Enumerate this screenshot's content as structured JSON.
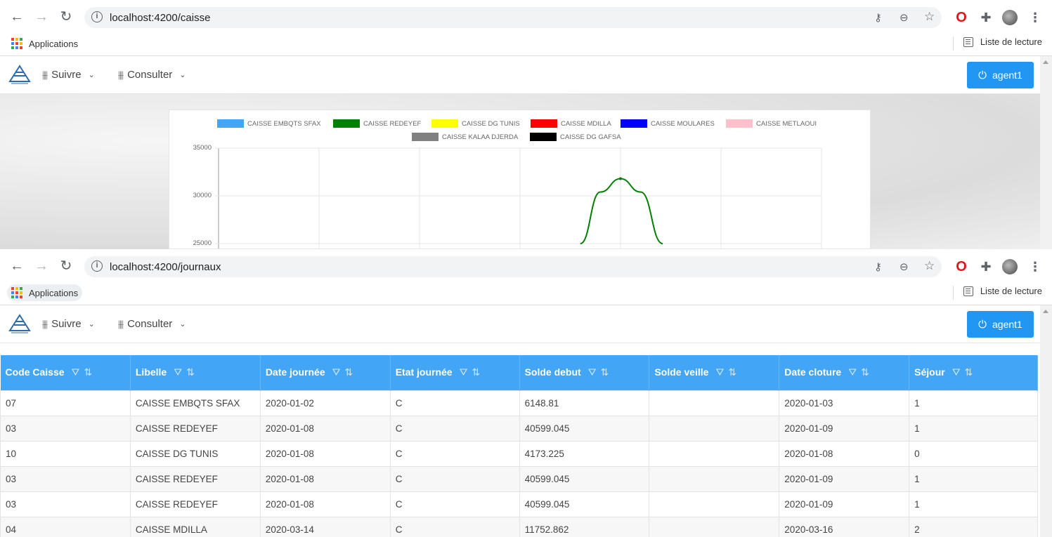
{
  "screens": [
    {
      "url": "localhost:4200/caisse",
      "bookmarks": {
        "apps": "Applications",
        "reading_list": "Liste de lecture"
      },
      "nav": {
        "menu": [
          "Suivre",
          "Consulter"
        ],
        "user": "agent1"
      },
      "chart_data": {
        "type": "line",
        "title": "",
        "xlabel": "",
        "ylabel": "",
        "legend": [
          "CAISSE EMBQTS SFAX",
          "CAISSE REDEYEF",
          "CAISSE DG TUNIS",
          "CAISSE MDILLA",
          "CAISSE MOULARES",
          "CAISSE METLAOUI",
          "CAISSE KALAA DJERDA",
          "CAISSE DG GAFSA"
        ],
        "legend_colors": [
          "#42a5f5",
          "#008000",
          "#ffff00",
          "#ff0000",
          "#0000ff",
          "#ffc0cb",
          "#808080",
          "#000000"
        ],
        "legend_position": "top",
        "y_ticks_visible": [
          "35000",
          "30000",
          "25000"
        ],
        "ylim": [
          25000,
          35000
        ],
        "grid": true,
        "series": [
          {
            "name": "CAISSE REDEYEF",
            "color": "#008000",
            "x": [
              3.6,
              3.8,
              4.0,
              4.2,
              4.42
            ],
            "values": [
              25000,
              30400,
              31800,
              30400,
              25000
            ]
          }
        ]
      }
    },
    {
      "url": "localhost:4200/journaux",
      "bookmarks": {
        "apps": "Applications",
        "reading_list": "Liste de lecture"
      },
      "nav": {
        "menu": [
          "Suivre",
          "Consulter"
        ],
        "user": "agent1"
      },
      "table": {
        "columns": [
          "Code Caisse",
          "Libelle",
          "Date journée",
          "Etat journée",
          "Solde debut",
          "Solde veille",
          "Date cloture",
          "Séjour"
        ],
        "rows": [
          [
            "07",
            "CAISSE EMBQTS SFAX",
            "2020-01-02",
            "C",
            "6148.81",
            "",
            "2020-01-03",
            "1"
          ],
          [
            "03",
            "CAISSE REDEYEF",
            "2020-01-08",
            "C",
            "40599.045",
            "",
            "2020-01-09",
            "1"
          ],
          [
            "10",
            "CAISSE DG TUNIS",
            "2020-01-08",
            "C",
            "4173.225",
            "",
            "2020-01-08",
            "0"
          ],
          [
            "03",
            "CAISSE REDEYEF",
            "2020-01-08",
            "C",
            "40599.045",
            "",
            "2020-01-09",
            "1"
          ],
          [
            "03",
            "CAISSE REDEYEF",
            "2020-01-08",
            "C",
            "40599.045",
            "",
            "2020-01-09",
            "1"
          ],
          [
            "04",
            "CAISSE MDILLA",
            "2020-03-14",
            "C",
            "11752.862",
            "",
            "2020-03-16",
            "2"
          ]
        ]
      }
    }
  ]
}
